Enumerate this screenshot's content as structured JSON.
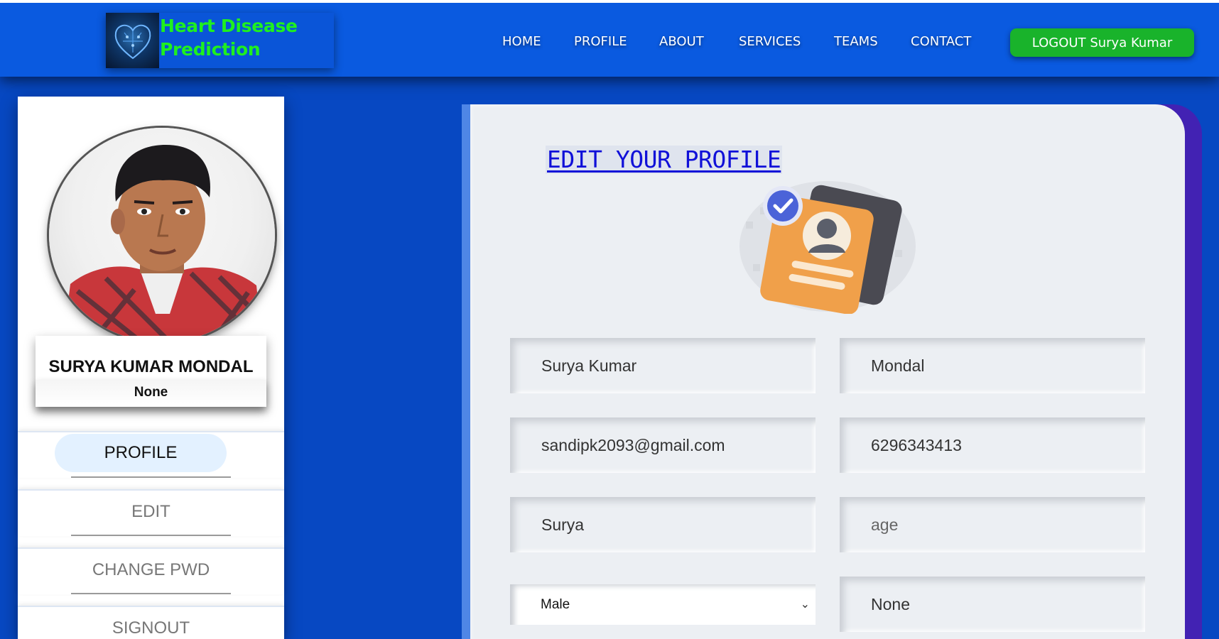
{
  "brand": {
    "line1": "Heart Disease",
    "line2": "Prediction",
    "color": "#1ff01f"
  },
  "nav": {
    "items": [
      {
        "label": "HOME"
      },
      {
        "label": "PROFILE"
      },
      {
        "label": "ABOUT"
      },
      {
        "label": "SERVICES"
      },
      {
        "label": "TEAMS"
      },
      {
        "label": "CONTACT"
      }
    ],
    "logout": "LOGOUT Surya Kumar"
  },
  "sidebar": {
    "avatar_icon": "user-photo",
    "full_name": "SURYA KUMAR MONDAL",
    "subtitle": "None",
    "menu": [
      {
        "label": "PROFILE",
        "active": true
      },
      {
        "label": "EDIT"
      },
      {
        "label": "CHANGE PWD"
      },
      {
        "label": "SIGNOUT"
      }
    ]
  },
  "form": {
    "title": "EDIT YOUR PROFILE",
    "illustration": "profile-card-icon",
    "fields": {
      "first_name": "Surya Kumar",
      "last_name": "Mondal",
      "email": "sandipk2093@gmail.com",
      "phone": "6296343413",
      "username": "Surya",
      "age_placeholder": "age",
      "gender": "Male",
      "extra": "None"
    }
  },
  "colors": {
    "navbar": "#0a5ae0",
    "background": "#0748c2",
    "logout": "#19b32b",
    "title": "#1010d8",
    "panel_accent": "#4222b3"
  }
}
